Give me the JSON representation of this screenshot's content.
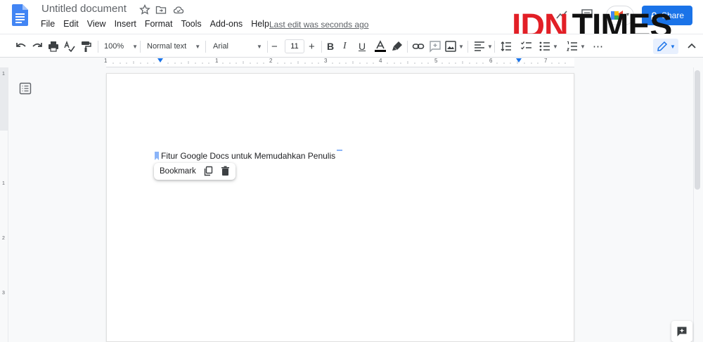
{
  "app": {
    "title": "Untitled document",
    "last_edit": "Last edit was seconds ago",
    "share_label": "Share"
  },
  "menu": [
    "File",
    "Edit",
    "View",
    "Insert",
    "Format",
    "Tools",
    "Add-ons",
    "Help"
  ],
  "toolbar": {
    "zoom": "100%",
    "style": "Normal text",
    "font": "Arial",
    "font_size": "11"
  },
  "ruler": {
    "numbers": [
      "1",
      "1",
      "2",
      "3",
      "4",
      "5",
      "6",
      "7"
    ]
  },
  "vruler": {
    "numbers": [
      "1",
      "1",
      "2",
      "3"
    ]
  },
  "document": {
    "text": "Fitur Google Docs untuk Memudahkan Penulis"
  },
  "bookmark_popup": {
    "label": "Bookmark"
  },
  "watermark": {
    "part1": "IDN",
    "part2": "TIMES"
  },
  "colors": {
    "accent": "#1a73e8",
    "brand_red": "#e21f26",
    "bookmark": "#8ab4f8"
  }
}
